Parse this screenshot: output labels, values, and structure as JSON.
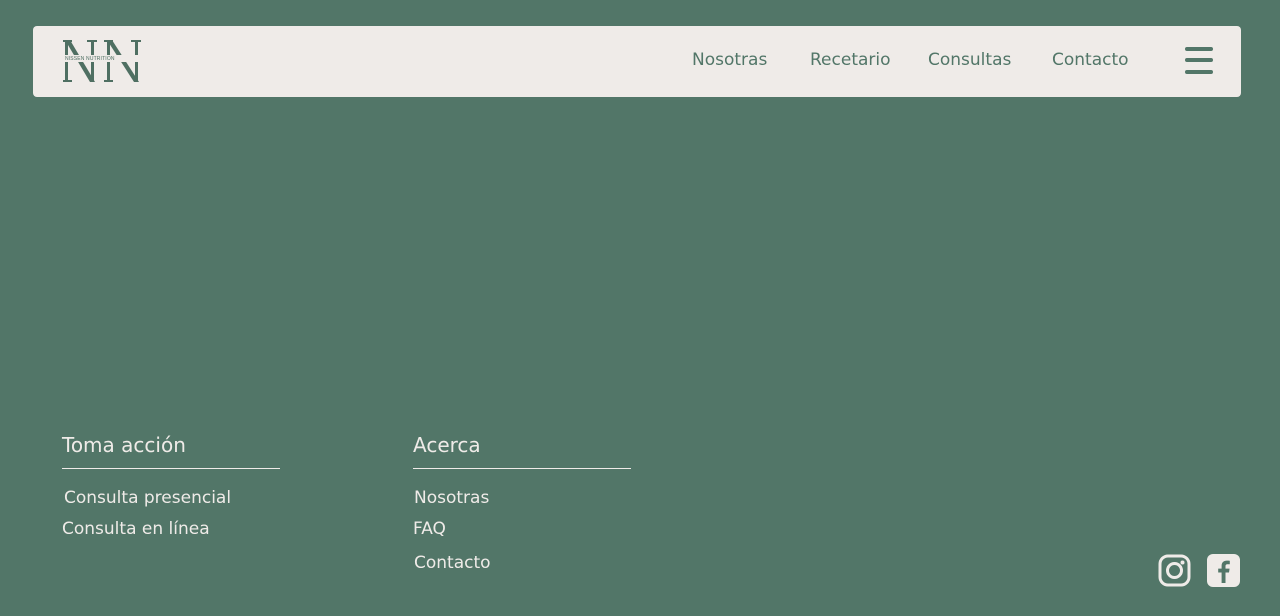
{
  "header": {
    "logo_text": "NISSEN NUTRITION",
    "nav": [
      {
        "label": "Nosotras"
      },
      {
        "label": "Recetario"
      },
      {
        "label": "Consultas"
      },
      {
        "label": "Contacto"
      }
    ],
    "menu_icon": "hamburger-menu-icon"
  },
  "footer": {
    "columns": [
      {
        "heading": "Toma acción",
        "links": [
          "Consulta presencial",
          "Consulta en línea"
        ]
      },
      {
        "heading": "Acerca",
        "links": [
          "Nosotras",
          "FAQ",
          "Contacto"
        ]
      }
    ],
    "social": [
      {
        "icon": "instagram-icon"
      },
      {
        "icon": "facebook-icon"
      }
    ]
  },
  "colors": {
    "background": "#527668",
    "navbar": "#efebe8",
    "text_light": "#efebe8",
    "accent": "#527668"
  }
}
